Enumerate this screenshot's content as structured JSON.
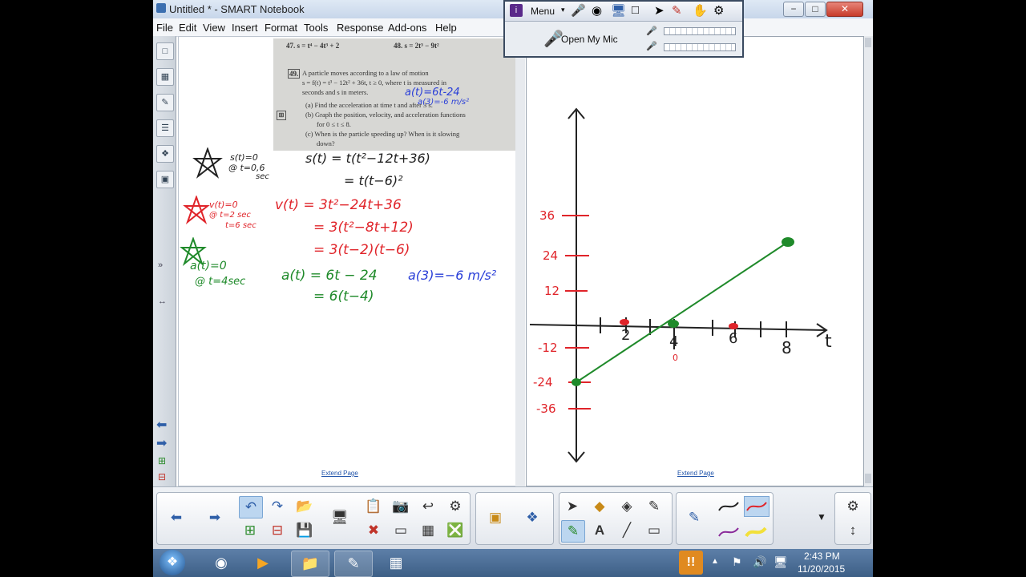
{
  "window": {
    "title": "Untitled * - SMART Notebook",
    "minimize": "−",
    "maximize": "□",
    "close": "✕"
  },
  "menu": [
    "File",
    "Edit",
    "View",
    "Insert",
    "Format",
    "Tools",
    "Response",
    "Add-ons",
    "Help"
  ],
  "mic_panel": {
    "menu_label": "Menu",
    "open_mic_label": "Open My Mic"
  },
  "textbook": {
    "problem47": "47.  s = t⁴ − 4t³ + 2",
    "problem48": "48.  s = 2t³ − 9t²",
    "problem49_num": "49.",
    "problem49_line1": "A particle moves according to a law of motion",
    "problem49_line2": "s = f(t) = t³ − 12t² + 36t,  t ≥ 0, where t is measured in",
    "problem49_line3": "seconds and s in meters.",
    "part_a": "(a) Find the acceleration at time t and after 3 s.",
    "part_b": "(b) Graph the position, velocity, and acceleration functions",
    "part_b2": "for 0 ≤ t ≤ 8.",
    "part_c": "(c) When is the particle speeding up? When is it slowing",
    "part_c2": "down?"
  },
  "handwriting": {
    "blue_top": "a(t)=6t-24",
    "blue_top2": "a(3)=-6 m/s²",
    "s_note1": "s(t)=0",
    "s_note2": "@ t=0,6",
    "s_note3": "sec",
    "s_eq1": "s(t) = t(t²−12t+36)",
    "s_eq2": "= t(t−6)²",
    "v_note1": "v(t)=0",
    "v_note2": "@ t=2 sec",
    "v_note3": "t=6 sec",
    "v_eq1": "v(t) = 3t²−24t+36",
    "v_eq2": "= 3(t²−8t+12)",
    "v_eq3": "= 3(t−2)(t−6)",
    "a_note1": "a(t)=0",
    "a_note2": "@ t=4sec",
    "a_eq1": "a(t) = 6t − 24",
    "a_eq2": "= 6(t−4)",
    "a_blue": "a(3)=−6 m/s²"
  },
  "graph": {
    "y_ticks": [
      "36",
      "24",
      "12",
      "-12",
      "-24",
      "-36"
    ],
    "x_ticks": [
      "2",
      "4",
      "6",
      "8"
    ],
    "x_axis_label": "t",
    "zero_label": "0"
  },
  "pages": {
    "extend_left": "Extend Page",
    "extend_right": "Extend Page"
  },
  "taskbar": {
    "time": "2:43 PM",
    "date": "11/20/2015"
  },
  "colors": {
    "red": "#e0242a",
    "green": "#1f8a2a",
    "blue": "#2a3fd8",
    "black": "#222222"
  }
}
